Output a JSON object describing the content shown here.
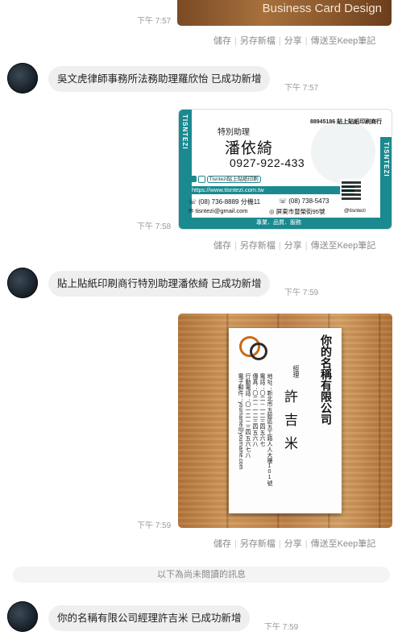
{
  "messages": [
    {
      "time": "下午 7:57"
    },
    {
      "time": "下午 7:57",
      "text": "吳文虎律師事務所法務助理羅欣怡 已成功新增"
    },
    {
      "time": "下午 7:58"
    },
    {
      "time": "下午 7:59",
      "text": "貼上貼紙印刷商行特別助理潘依綺 已成功新增"
    },
    {
      "time": "下午 7:59"
    },
    {
      "time": "下午 7:59",
      "text": "你的名稱有限公司經理許吉米 已成功新增"
    }
  ],
  "actions": [
    "儲存",
    "另存新檔",
    "分享",
    "傳送至Keep筆記"
  ],
  "unread_divider": "以下為尚未閱讀的訊息",
  "card0": {
    "banner": "Business Card Design"
  },
  "card1": {
    "brand_side": "TISNTEZI",
    "id_line": "88945186 貼上貼紙印刷商行",
    "title": "特別助理",
    "name": "潘依綺",
    "mobile": "0927-922-433",
    "social": "Tisntezi貼上貼紙印刷",
    "url": "https://www.tisntezi.com.tw",
    "phone": "(08) 736-8889 分機11",
    "fax": "(08) 738-5473",
    "email": "tisntezi@gmail.com",
    "address": "屏東市豐榮街95號",
    "ig": "@tisntezi",
    "footer": "專業．品質．服務"
  },
  "card2": {
    "company": "你的名稱有限公司",
    "position": "經理",
    "name": "許吉米",
    "address": "地址：新北市五股區五工路人人大樓101號",
    "tel": "電話：〇二－一二三四五六七",
    "fax": "傳真：〇二－一二三四五六八",
    "mobile": "行動電話：〇一二－三四五六七八",
    "email": "電子郵件：yourname@yourname.com"
  },
  "colors": {
    "bubble": "#efefef",
    "teal": "#1a8a90",
    "time": "#9a9a9a",
    "wood": "#c2834a"
  }
}
